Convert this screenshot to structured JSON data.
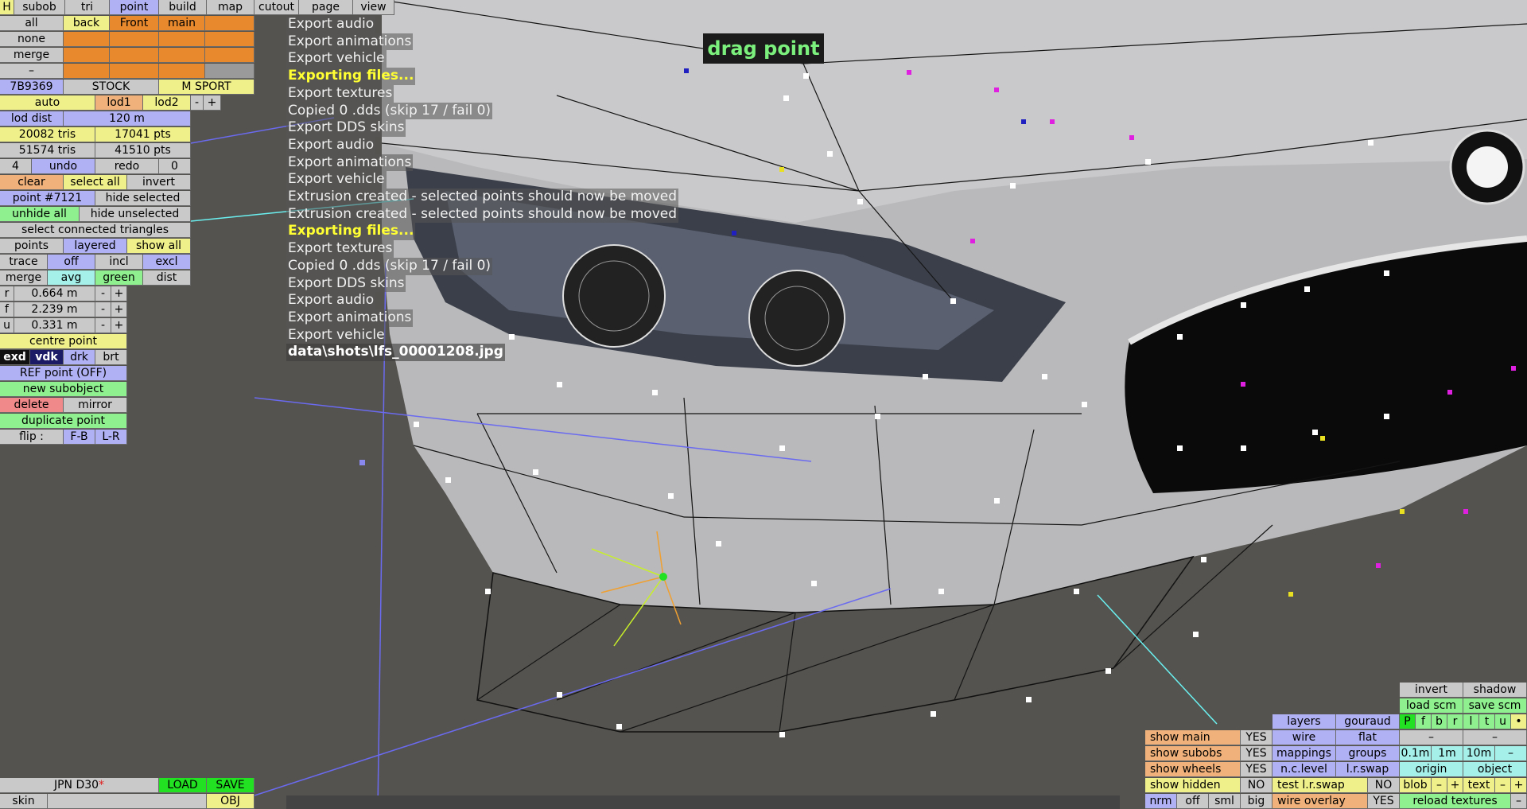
{
  "top_menu": {
    "h": "H",
    "tabs": [
      "subob",
      "tri",
      "point",
      "build",
      "map",
      "cutout",
      "page",
      "view"
    ],
    "active_tab": "point"
  },
  "left_panel": {
    "all": "all",
    "back": "back",
    "front": "Front",
    "main": "main",
    "none": "none",
    "merge": "merge",
    "dash": "–",
    "car_id": "7B9369",
    "stock": "STOCK",
    "msport": "M SPORT",
    "auto": "auto",
    "lod1": "lod1",
    "lod2": "lod2",
    "minus": "-",
    "plus": "+",
    "lod_dist_label": "lod dist",
    "lod_dist_value": "120 m",
    "tris1": "20082 tris",
    "pts1": "17041 pts",
    "tris2": "51574 tris",
    "pts2": "41510 pts",
    "undo_count": "4",
    "undo": "undo",
    "redo": "redo",
    "redo_count": "0",
    "clear": "clear",
    "select_all": "select all",
    "invert": "invert",
    "point_num": "point #7121",
    "hide_selected": "hide selected",
    "unhide_all": "unhide all",
    "hide_unselected": "hide unselected",
    "select_connected": "select connected triangles",
    "points": "points",
    "layered": "layered",
    "show_all": "show all",
    "trace": "trace",
    "off": "off",
    "incl": "incl",
    "excl": "excl",
    "merge2": "merge",
    "avg": "avg",
    "green": "green",
    "dist": "dist",
    "r_label": "r",
    "r_value": "0.664 m",
    "f_label": "f",
    "f_value": "2.239 m",
    "u_label": "u",
    "u_value": "0.331 m",
    "centre_point": "centre point",
    "exd": "exd",
    "vdk": "vdk",
    "drk": "drk",
    "brt": "brt",
    "ref_point": "REF point (OFF)",
    "new_subobject": "new subobject",
    "delete": "delete",
    "mirror": "mirror",
    "duplicate_point": "duplicate point",
    "flip": "flip :",
    "fb": "F-B",
    "lr": "L-R"
  },
  "bottom_left": {
    "car_name": "JPN D30",
    "asterisk": "*",
    "load": "LOAD",
    "save": "SAVE",
    "skin": "skin",
    "obj": "OBJ"
  },
  "log_lines": [
    {
      "text": "Export audio",
      "hl": false
    },
    {
      "text": "Export animations",
      "hl": false
    },
    {
      "text": "Export vehicle",
      "hl": false
    },
    {
      "text": "Exporting files...",
      "hl": true
    },
    {
      "text": "Export textures",
      "hl": false
    },
    {
      "text": "Copied 0 .dds (skip 17 / fail 0)",
      "hl": false
    },
    {
      "text": "Export DDS skins",
      "hl": false
    },
    {
      "text": "Export audio",
      "hl": false
    },
    {
      "text": "Export animations",
      "hl": false
    },
    {
      "text": "Export vehicle",
      "hl": false
    },
    {
      "text": "Extrusion created - selected points should now be moved",
      "hl": false
    },
    {
      "text": "Extrusion created - selected points should now be moved",
      "hl": false
    },
    {
      "text": "Exporting files...",
      "hl": true
    },
    {
      "text": "Export textures",
      "hl": false
    },
    {
      "text": "Copied 0 .dds (skip 17 / fail 0)",
      "hl": false
    },
    {
      "text": "Export DDS skins",
      "hl": false
    },
    {
      "text": "Export audio",
      "hl": false
    },
    {
      "text": "Export animations",
      "hl": false
    },
    {
      "text": "Export vehicle",
      "hl": false
    }
  ],
  "log_last": "data\\shots\\lfs_00001208.jpg",
  "drag_label": "drag point",
  "right_panel": {
    "invert": "invert",
    "shadow": "shadow",
    "load_scm": "load scm",
    "save_scm": "save scm",
    "layers": "layers",
    "gouraud": "gouraud",
    "letters": [
      "P",
      "f",
      "b",
      "r",
      "l",
      "t",
      "u"
    ],
    "dot": "•",
    "wire": "wire",
    "flat": "flat",
    "dash": "–",
    "show_main": "show main",
    "show_main_v": "YES",
    "show_subobs": "show subobs",
    "show_subobs_v": "YES",
    "mappings": "mappings",
    "groups": "groups",
    "m01": "0.1m",
    "m1": "1m",
    "m10": "10m",
    "minus": "–",
    "show_wheels": "show wheels",
    "show_wheels_v": "YES",
    "nclevel": "n.c.level",
    "lrswap": "l.r.swap",
    "origin": "origin",
    "object": "object",
    "show_hidden": "show hidden",
    "show_hidden_v": "NO",
    "test_lrswap": "test l.r.swap",
    "test_lrswap_v": "NO",
    "blob": "blob",
    "text": "text",
    "pm_minus": "–",
    "pm_plus": "+",
    "nrm": "nrm",
    "off": "off",
    "sml": "sml",
    "big": "big",
    "wire_overlay": "wire overlay",
    "wire_overlay_v": "YES",
    "reload_textures": "reload textures",
    "tail": "–"
  },
  "colors": {
    "accent_blue": "#b0b0f4",
    "accent_green": "#8ef08e",
    "accent_yellow": "#f0f08a"
  }
}
